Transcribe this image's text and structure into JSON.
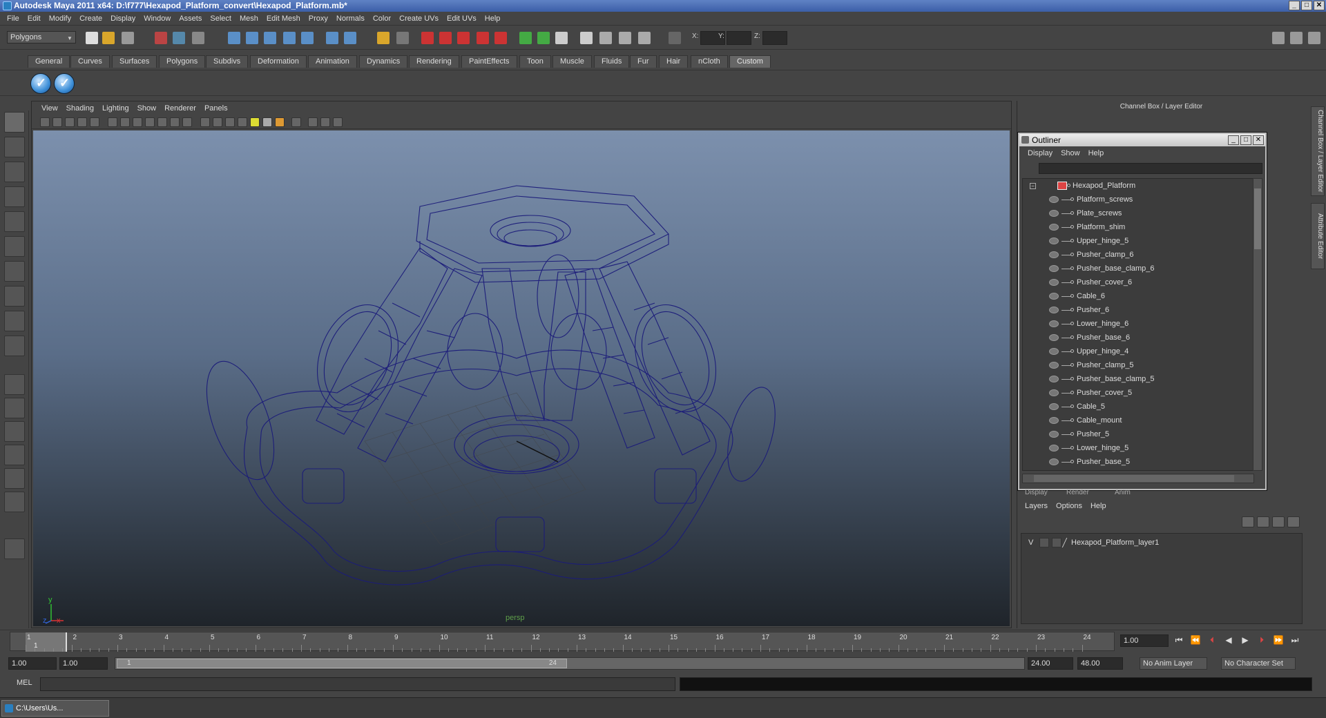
{
  "window": {
    "title": "Autodesk Maya 2011 x64: D:\\f777\\Hexapod_Platform_convert\\Hexapod_Platform.mb*",
    "controls": [
      "_",
      "□",
      "✕"
    ]
  },
  "menubar": [
    "File",
    "Edit",
    "Modify",
    "Create",
    "Display",
    "Window",
    "Assets",
    "Select",
    "Mesh",
    "Edit Mesh",
    "Proxy",
    "Normals",
    "Color",
    "Create UVs",
    "Edit UVs",
    "Help"
  ],
  "statusline": {
    "mode_selector": "Polygons",
    "coord_labels": [
      "X:",
      "Y:",
      "Z:"
    ]
  },
  "shelf": {
    "tabs": [
      "General",
      "Curves",
      "Surfaces",
      "Polygons",
      "Subdivs",
      "Deformation",
      "Animation",
      "Dynamics",
      "Rendering",
      "PaintEffects",
      "Toon",
      "Muscle",
      "Fluids",
      "Fur",
      "Hair",
      "nCloth",
      "Custom"
    ],
    "active_tab": "Custom"
  },
  "viewport": {
    "menu": [
      "View",
      "Shading",
      "Lighting",
      "Show",
      "Renderer",
      "Panels"
    ],
    "camera_label": "persp",
    "axis_x": "x",
    "axis_y": "y",
    "axis_z": "z",
    "wire_color": "#1b1b7a"
  },
  "channel_box": {
    "title": "Channel Box / Layer Editor"
  },
  "outliner": {
    "title": "Outliner",
    "menu": [
      "Display",
      "Show",
      "Help"
    ],
    "root": "Hexapod_Platform",
    "items": [
      "Platform_screws",
      "Plate_screws",
      "Platform_shim",
      "Upper_hinge_5",
      "Pusher_clamp_6",
      "Pusher_base_clamp_6",
      "Pusher_cover_6",
      "Cable_6",
      "Pusher_6",
      "Lower_hinge_6",
      "Pusher_base_6",
      "Upper_hinge_4",
      "Pusher_clamp_5",
      "Pusher_base_clamp_5",
      "Pusher_cover_5",
      "Cable_5",
      "Cable_mount",
      "Pusher_5",
      "Lower_hinge_5",
      "Pusher_base_5"
    ]
  },
  "layer_editor": {
    "tabs": [
      "Display",
      "Render",
      "Anim"
    ],
    "menu": [
      "Layers",
      "Options",
      "Help"
    ],
    "layer": {
      "visible": "V",
      "name": "Hexapod_Platform_layer1"
    }
  },
  "side_tabs": [
    "Channel Box / Layer Editor",
    "Attribute Editor"
  ],
  "timeline": {
    "ticks": [
      "1",
      "2",
      "3",
      "4",
      "5",
      "6",
      "7",
      "8",
      "9",
      "10",
      "11",
      "12",
      "13",
      "14",
      "15",
      "16",
      "17",
      "18",
      "19",
      "20",
      "21",
      "22",
      "23",
      "24"
    ],
    "current_frame_label": "1",
    "current_time": "1.00"
  },
  "range": {
    "start": "1.00",
    "playback_start": "1.00",
    "slider_start": "1",
    "slider_end": "24",
    "playback_end": "24.00",
    "end": "48.00",
    "anim_layer": "No Anim Layer",
    "character_set": "No Character Set"
  },
  "command_line": {
    "label": "MEL"
  },
  "taskbar": {
    "item": "C:\\Users\\Us..."
  }
}
